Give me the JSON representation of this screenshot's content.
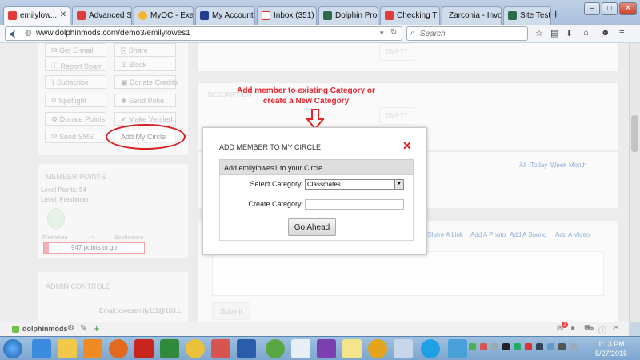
{
  "browser": {
    "tabs": [
      {
        "label": "emilylow...",
        "active": true,
        "icon": "dolphin-red-icon"
      },
      {
        "label": "Advanced Se...",
        "active": false,
        "icon": "dolphin-red-icon"
      },
      {
        "label": "MyOC - Exams",
        "active": false,
        "icon": "star-icon"
      },
      {
        "label": "My Account ...",
        "active": false,
        "icon": "paypal-icon"
      },
      {
        "label": "Inbox (351) - ...",
        "active": false,
        "icon": "gmail-icon"
      },
      {
        "label": "Dolphin Pro ...",
        "active": false,
        "icon": "dolphin-pro-icon"
      },
      {
        "label": "Checking Thi...",
        "active": false,
        "icon": "dolphin-red-icon"
      },
      {
        "label": "Zarconia - Invoic...",
        "active": false,
        "icon": "blank-icon"
      },
      {
        "label": "Site Testimo...",
        "active": false,
        "icon": "dolphin-pro-icon"
      }
    ],
    "url": "www.dolphinmods.com/demo3/emilylowes1",
    "search_placeholder": "Search"
  },
  "profile_actions": {
    "buttons": [
      "Get E-mail",
      "Share",
      "Report Spam",
      "Block",
      "Subscribe",
      "Donate Credits",
      "Spotlight",
      "Send Poke",
      "Donate Points",
      "Make Verified",
      "Send SMS",
      "Add My Circle"
    ]
  },
  "member_points": {
    "heading": "MEMBER POINTS",
    "level_points": "Level Points: 54",
    "level": "Level: Freshman",
    "from_level": "Freshman",
    "arrow": "-->",
    "to_level": "Sophomore",
    "progress_text": "947 points to go",
    "progress_fraction": 0.05
  },
  "admin_controls": {
    "heading": "ADMIN CONTROLS",
    "email_label": "Email:",
    "email_value": "lowesemily111@163.c"
  },
  "center": {
    "empty_label_1": "EMPTY",
    "description_label": "DESCRIPTION",
    "empty_label_2": "EMPTY",
    "filters": [
      "All",
      "Today",
      "Week",
      "Month"
    ],
    "share_links": [
      "Share A Link",
      "Add A Photo",
      "Add A Sound",
      "Add A Video"
    ],
    "submit_label": "Submit"
  },
  "annotation": {
    "text": "Add member to existing Category or create a New Category",
    "color": "#e8212a"
  },
  "modal": {
    "title": "ADD MEMBER TO MY CIRCLE",
    "header": "Add emilylowes1 to your Circle",
    "select_label": "Select Category:",
    "select_value": "Classmates",
    "create_label": "Create Category:",
    "create_value": "",
    "submit_label": "Go Ahead"
  },
  "bottombar": {
    "site_name": "dolphinmods",
    "notification_count": "2"
  },
  "taskbar": {
    "time": "1:13 PM",
    "date": "5/27/2015"
  }
}
